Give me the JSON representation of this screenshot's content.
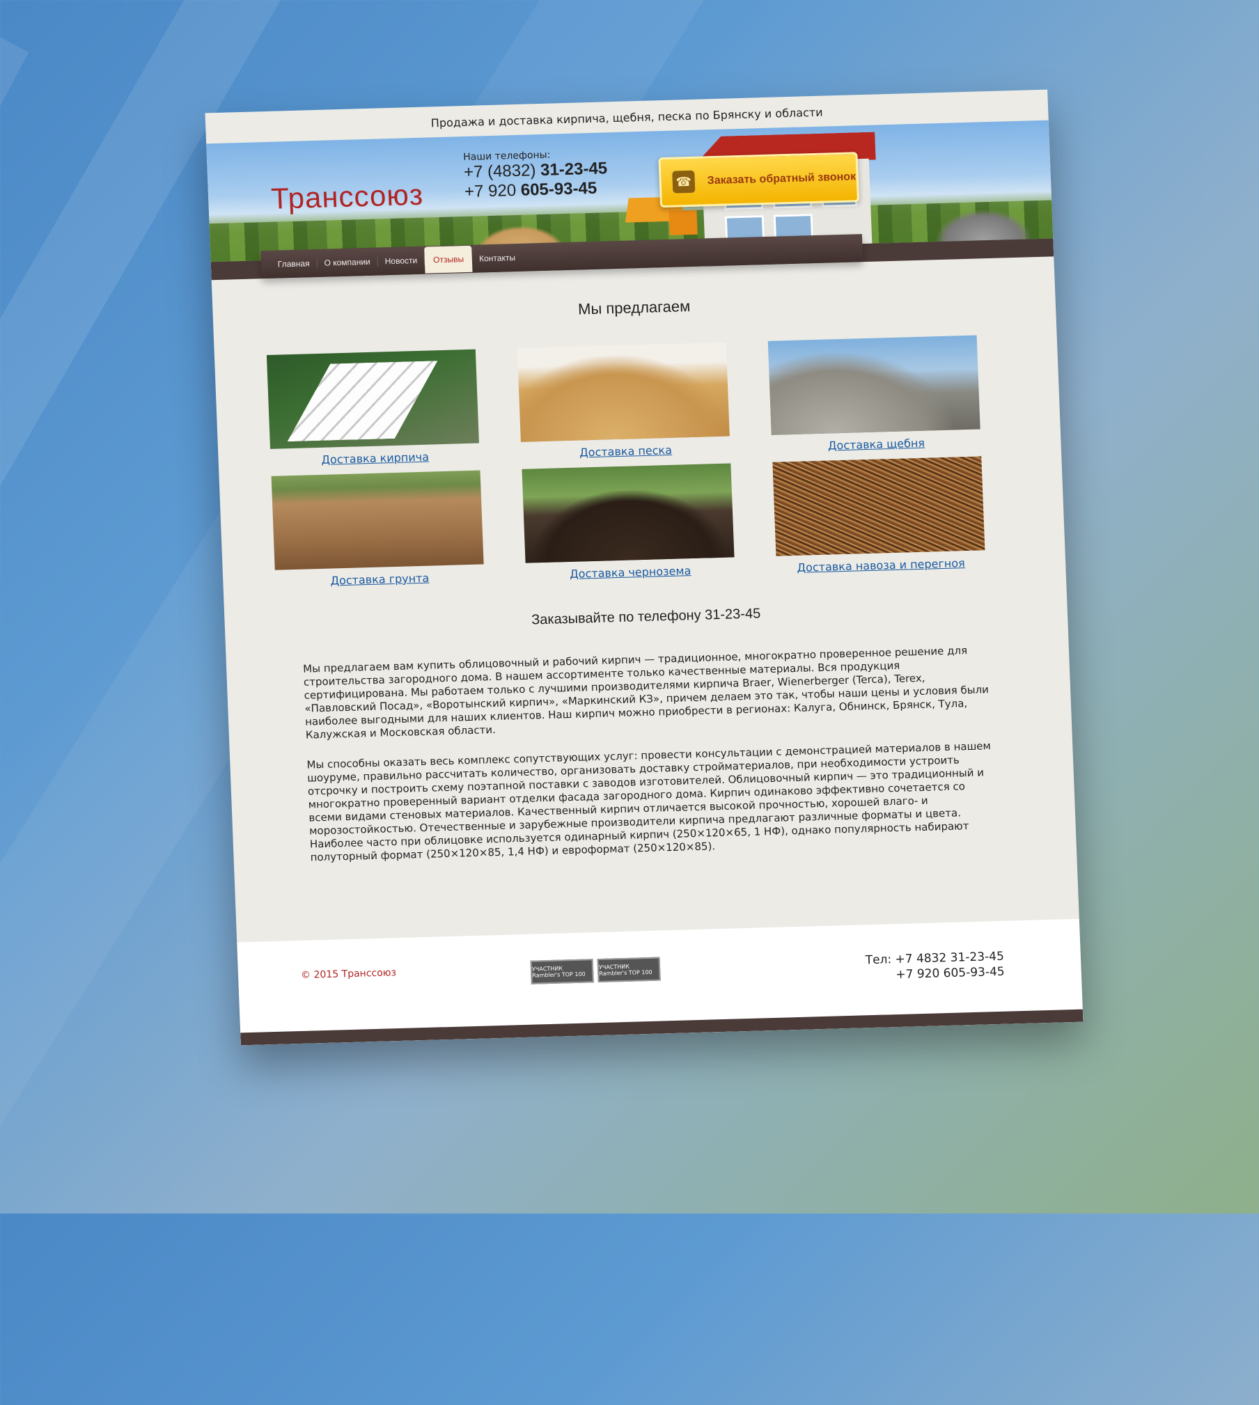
{
  "tagline": "Продажа и доставка кирпича, щебня, песка по Брянску и области",
  "brand": "Транссоюз",
  "header": {
    "phones_label": "Наши телефоны:",
    "phone1_prefix": "+7 (4832) ",
    "phone1_number": "31-23-45",
    "phone2_prefix": "+7 920 ",
    "phone2_number": "605-93-45",
    "callback_label": "Заказать обратный звонок",
    "callback_icon": "phone-icon"
  },
  "nav": [
    {
      "label": "Главная"
    },
    {
      "label": "О компании"
    },
    {
      "label": "Новости"
    },
    {
      "label": "Отзывы",
      "active": true
    },
    {
      "label": "Контакты"
    }
  ],
  "offer_title": "Мы предлагаем",
  "products": [
    {
      "label": "Доставка кирпича"
    },
    {
      "label": "Доставка песка"
    },
    {
      "label": "Доставка щебня"
    },
    {
      "label": "Доставка грунта"
    },
    {
      "label": "Доставка чернозема"
    },
    {
      "label": "Доставка навоза и перегноя"
    }
  ],
  "order_title": "Заказывайте по телефону 31-23-45",
  "paragraphs": [
    "Мы предлагаем вам купить облицовочный и рабочий кирпич — традиционное, многократно проверенное решение для строительства загородного дома. В нашем ассортименте только качественные материалы. Вся продукция сертифицирована. Мы работаем только с лучшими производителями кирпича Braer, Wienerberger (Terca), Terex, «Павловский Посад», «Воротынский кирпич», «Маркинский КЗ», причем делаем это так, чтобы наши цены и условия были наиболее выгодными для наших клиентов. Наш кирпич можно приобрести в регионах: Калуга, Обнинск, Брянск, Тула, Калужская и Московская области.",
    "Мы способны оказать весь комплекс сопутствующих услуг: провести консультации с демонстрацией материалов в нашем шоуруме, правильно рассчитать количество, организовать доставку стройматериалов, при необходимости устроить отсрочку и построить схему поэтапной поставки с заводов изготовителей. Облицовочный кирпич — это традиционный и многократно проверенный вариант отделки фасада загородного дома. Кирпич одинаково эффективно сочетается со всеми видами стеновых материалов. Качественный кирпич отличается высокой прочностью, хорошей влаго- и морозостойкостью. Отечественные и зарубежные производители кирпича предлагают различные форматы и цвета. Наиболее часто при облицовке используется одинарный кирпич (250×120×65, 1 НФ), однако популярность набирают полуторный формат (250×120×85, 1,4 НФ) и евроформат (250×120×85)."
  ],
  "footer": {
    "copyright": "© 2015  Транссоюз",
    "badge1": "УЧАСТНИК Rambler's TOP 100",
    "badge2": "УЧАСТНИК Rambler's TOP 100",
    "tel1": "Тел: +7 4832 31-23-45",
    "tel2": "+7 920 605-93-45"
  },
  "colors": {
    "brand_red": "#b02424",
    "nav_brown": "#4a3a38",
    "callback_yellow": "#f4b400",
    "link_blue": "#1a5aa0"
  }
}
